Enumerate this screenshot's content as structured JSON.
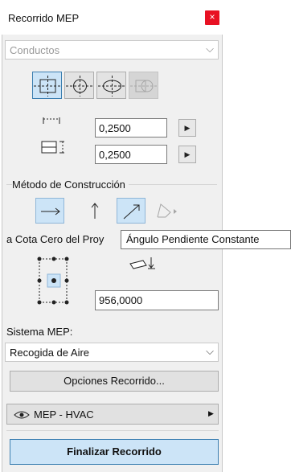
{
  "window": {
    "title": "Recorrido MEP",
    "close_glyph": "×"
  },
  "element_type": {
    "value": "Conductos",
    "enabled": false
  },
  "shape_buttons": [
    {
      "icon": "rectangular-connector-icon",
      "selected": true,
      "enabled": true
    },
    {
      "icon": "circular-connector-icon",
      "selected": false,
      "enabled": true
    },
    {
      "icon": "oval-connector-icon",
      "selected": false,
      "enabled": true
    },
    {
      "icon": "transition-connector-icon",
      "selected": false,
      "enabled": false
    }
  ],
  "dimensions": {
    "width": "0,2500",
    "height": "0,2500"
  },
  "construction": {
    "label": "Método de Construcción",
    "methods": [
      {
        "icon": "horizontal-arrow-icon",
        "selected": true
      },
      {
        "icon": "vertical-arrow-icon",
        "selected": false
      },
      {
        "icon": "diagonal-arrow-icon",
        "selected": true
      },
      {
        "icon": "slope-flyout-icon",
        "selected": false
      }
    ]
  },
  "tooltip": "Ángulo Pendiente Constante",
  "elevation": {
    "label": "a Cota Cero del Proy",
    "value": "956,0000"
  },
  "mep_system": {
    "label": "Sistema MEP:",
    "value": "Recogida de Aire"
  },
  "routing_options_button": "Opciones Recorrido...",
  "layer": {
    "value": "MEP - HVAC"
  },
  "finish_button": "Finalizar Recorrido",
  "colors": {
    "accent": "#cce4f7",
    "accent_border": "#3c7fb1",
    "close": "#e81123"
  }
}
